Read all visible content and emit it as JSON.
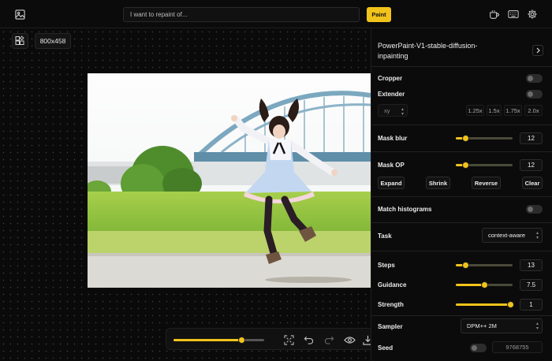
{
  "topbar": {
    "prompt_placeholder": "I want to repaint of...",
    "paint_label": "Paint",
    "icons": [
      "image-upload-icon",
      "coffee-icon",
      "keyboard-icon",
      "settings-icon"
    ]
  },
  "canvas": {
    "size_label": "800x458"
  },
  "panel": {
    "model_name": "PowerPaint-V1-stable-diffusion-inpainting",
    "cropper_label": "Cropper",
    "extender_label": "Extender",
    "extender_direction": "xy",
    "scale_options": [
      "1.25x",
      "1.5x",
      "1.75x",
      "2.0x"
    ],
    "mask_blur_label": "Mask blur",
    "mask_blur_value": "12",
    "mask_op_label": "Mask OP",
    "mask_op_value": "12",
    "mask_buttons": [
      "Expand",
      "Shrink",
      "Reverse",
      "Clear"
    ],
    "match_histograms_label": "Match histograms",
    "task_label": "Task",
    "task_value": "context-aware",
    "steps_label": "Steps",
    "steps_value": "13",
    "guidance_label": "Guidance",
    "guidance_value": "7.5",
    "strength_label": "Strength",
    "strength_value": "1",
    "sampler_label": "Sampler",
    "sampler_value": "DPM++ 2M",
    "seed_label": "Seed",
    "seed_value": "9768755"
  },
  "sliders": {
    "brush_size": 0.75,
    "mask_blur": 0.17,
    "mask_op": 0.17,
    "steps": 0.17,
    "guidance": 0.5,
    "strength": 0.96
  },
  "colors": {
    "accent": "#f2c31b",
    "background": "#050505",
    "panel": "#0b0b0b"
  }
}
